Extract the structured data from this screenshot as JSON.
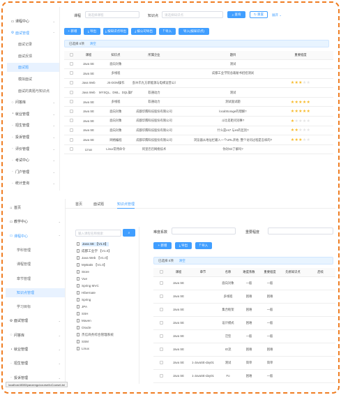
{
  "shot1": {
    "sidebar": [
      {
        "label": "课程中心",
        "icon": "monitor-icon",
        "glyph": "▭",
        "kind": "group",
        "chev": "⌄"
      },
      {
        "label": "面试管理",
        "icon": "settings-icon",
        "glyph": "⚙",
        "kind": "group-open",
        "chev": "⌃"
      },
      {
        "label": "面试记录",
        "kind": "sub"
      },
      {
        "label": "面试反馈",
        "kind": "sub"
      },
      {
        "label": "面试题",
        "kind": "sub-active"
      },
      {
        "label": "模拟面试",
        "kind": "sub"
      },
      {
        "label": "面试的真题与知识点",
        "kind": "sub"
      },
      {
        "label": "问答库",
        "icon": "chat-icon",
        "glyph": "◌",
        "kind": "group",
        "chev": "⌄"
      },
      {
        "label": "就业管理",
        "icon": "user-icon",
        "glyph": "◔",
        "kind": "group",
        "chev": "⌄"
      },
      {
        "label": "招生管理",
        "kind": "group",
        "chev": "⌄"
      },
      {
        "label": "投诉管理",
        "kind": "group",
        "chev": "⌄"
      },
      {
        "label": "评价管理",
        "kind": "group",
        "chev": "⌄"
      },
      {
        "label": "考试中心",
        "kind": "group",
        "chev": "⌄"
      },
      {
        "label": "门户管理",
        "kind": "group",
        "chev": "⌄"
      },
      {
        "label": "统计查询",
        "kind": "group",
        "chev": "⌄"
      }
    ],
    "filter": {
      "course_label": "课程",
      "course_placeholder": "请选择课程",
      "point_label": "知识点",
      "point_placeholder": "请选择知识点",
      "search_button": "查询",
      "reset_button": "重置",
      "collapse_link": "展开 ⌄"
    },
    "toolbar": [
      "+ 新增",
      "⤓ 导出",
      "⤓ 按知识点导出",
      "⤓ 按公司导出",
      "⤒ 导入",
      "导入(按知识点)"
    ],
    "selection": {
      "text": "已选择 0项",
      "clear": "清空"
    },
    "columns": [
      "",
      "课程",
      "知识点",
      "所属企业",
      "",
      "题目",
      "重要程度",
      ""
    ],
    "rows": [
      {
        "course": "Java SE",
        "point": "面向对象",
        "company": "",
        "question": "测试",
        "stars": 0
      },
      {
        "course": "Java SE",
        "point": "多线程",
        "company": "",
        "question": "成都工业学院总裁秘书招招测试",
        "stars": 0
      },
      {
        "course": "Java Web",
        "point": "JS-DOM操作",
        "company": "彭州市九方新能源与电梯运营公司",
        "question": "",
        "stars": 3
      },
      {
        "course": "Java Web",
        "point": "MYSQL、DML、DQL操作",
        "company": "软通动力",
        "question": "测试",
        "stars": 0
      },
      {
        "course": "Java SE",
        "point": "多线程",
        "company": "软通动力",
        "question": "测试面试题",
        "stars": 5
      },
      {
        "course": "Java SE",
        "point": "面向对象",
        "company": "成都华腾科技股份有限公司",
        "question": "localStorage的理解?",
        "stars": 5
      },
      {
        "course": "Java SE",
        "point": "面向对象",
        "company": "成都华腾科技股份有限公司",
        "question": "斗比差距问别事?",
        "stars": 1
      },
      {
        "course": "Java SE",
        "point": "面向对象",
        "company": "成都华腾科技股份有限公司",
        "question": "什么是es7 与es的区别?",
        "stars": 2
      },
      {
        "course": "Java SE",
        "point": "网络编程",
        "company": "成都华腾科技股份有限公司",
        "question": "浏览器从地址栏输入一个URL开始, 整个访问过程是怎样的?",
        "stars": 3
      },
      {
        "course": "Linux",
        "point": "Linux常用命令",
        "company": "阿里巴巴网络技术",
        "question": "你对Git了解吗?",
        "stars": 0
      }
    ]
  },
  "shot2": {
    "sidebar": [
      {
        "label": "首页",
        "icon": "home-icon",
        "glyph": "⌂",
        "kind": "group"
      },
      {
        "label": "教学中心",
        "icon": "monitor-icon",
        "glyph": "▭",
        "kind": "group",
        "chev": "⌄"
      },
      {
        "label": "课程中心",
        "icon": "monitor-icon",
        "glyph": "▭",
        "kind": "group-open",
        "chev": "⌃"
      },
      {
        "label": "学科管理",
        "kind": "sub"
      },
      {
        "label": "课程管理",
        "kind": "sub"
      },
      {
        "label": "章节管理",
        "kind": "sub"
      },
      {
        "label": "知识点管理",
        "kind": "sub-active"
      },
      {
        "label": "学习目标",
        "kind": "sub"
      },
      {
        "label": "面试管理",
        "icon": "settings-icon",
        "glyph": "⚙",
        "kind": "group",
        "chev": "⌄"
      },
      {
        "label": "问答库",
        "icon": "chat-icon",
        "glyph": "◌",
        "kind": "group",
        "chev": "⌄"
      },
      {
        "label": "就业管理",
        "icon": "user-icon",
        "glyph": "◔",
        "kind": "group",
        "chev": "⌄"
      },
      {
        "label": "招生管理",
        "kind": "group",
        "chev": "⌄"
      },
      {
        "label": "投诉管理",
        "kind": "group",
        "chev": "⌄"
      }
    ],
    "tabs": [
      "首页",
      "面试题",
      "知识点管理"
    ],
    "tree": {
      "placeholder": "输入课程名称搜索",
      "items": [
        {
          "label": "Java SE 【V1.0】",
          "hl": true
        },
        {
          "label": "成都工业学 【V1.0】"
        },
        {
          "label": "Java Web 【V1.0】"
        },
        {
          "label": "MyBatis 【V1.0】"
        },
        {
          "label": "Store"
        },
        {
          "label": "Vue"
        },
        {
          "label": "Spring MVC"
        },
        {
          "label": "Hibernate"
        },
        {
          "label": "Spring"
        },
        {
          "label": "JPA"
        },
        {
          "label": "SSH"
        },
        {
          "label": "Maven"
        },
        {
          "label": "Oracle"
        },
        {
          "label": "杰信商务综合管理系统"
        },
        {
          "label": "SSM"
        },
        {
          "label": "Linux"
        }
      ]
    },
    "filter": {
      "sys_label": "难度系数",
      "importance_label": "重要程度"
    },
    "toolbar": [
      "+ 新增",
      "⤓ 导出",
      "⤒ 导入"
    ],
    "selection": {
      "text": "已选择 0项",
      "clear": "清空"
    },
    "columns": [
      "",
      "课程",
      "章节",
      "名称",
      "难度系数",
      "重要程度",
      "先修知识点",
      "后续"
    ],
    "rows": [
      {
        "course": "Java SE",
        "chapter": "",
        "name": "面向对象",
        "difficulty": "一般",
        "importance": "一般"
      },
      {
        "course": "Java SE",
        "chapter": "",
        "name": "多线程",
        "difficulty": "困难",
        "importance": "困难"
      },
      {
        "course": "Java SE",
        "chapter": "",
        "name": "集合框架",
        "difficulty": "困难",
        "importance": "一般"
      },
      {
        "course": "Java SE",
        "chapter": "",
        "name": "设计模式",
        "difficulty": "困难",
        "importance": "一般"
      },
      {
        "course": "Java SE",
        "chapter": "",
        "name": "泛型",
        "difficulty": "一般",
        "importance": "一般"
      },
      {
        "course": "Java SE",
        "chapter": "",
        "name": "IO流",
        "difficulty": "困难",
        "importance": "困难"
      },
      {
        "course": "Java SE",
        "chapter": "1-JavaSE-day01",
        "name": "测试",
        "difficulty": "简单",
        "importance": "简单"
      },
      {
        "course": "Java SE",
        "chapter": "1-JavaSE-day01",
        "name": "Fo",
        "difficulty": "困难",
        "importance": "一般"
      }
    ],
    "status_url": "localhost:8080/yanzengc/course/toCourseList"
  },
  "colors": {
    "primary": "#409eff",
    "frame": "#ef7d22",
    "star": "#f7ba2a"
  }
}
